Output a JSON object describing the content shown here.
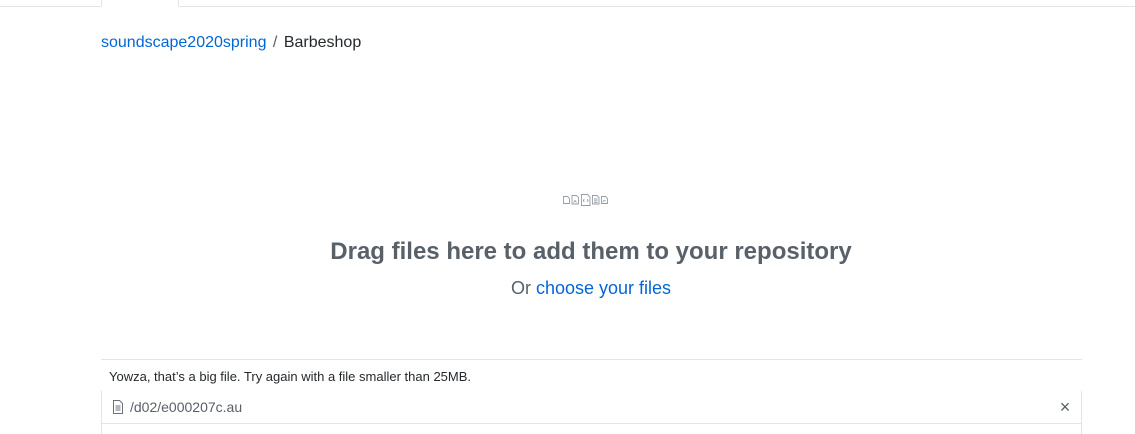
{
  "breadcrumb": {
    "owner": "soundscape2020spring",
    "separator": "/",
    "repo": "Barbeshop"
  },
  "dropzone": {
    "icons": [
      "file-icon",
      "file-media-icon",
      "file-code-icon",
      "file-text-icon",
      "file-pdf-icon"
    ],
    "title": "Drag files here to add them to your repository",
    "or_text": "Or",
    "choose_link": "choose your files"
  },
  "upload_error": {
    "message": "Yowza, that’s a big file. Try again with a file smaller than 25MB."
  },
  "files": [
    {
      "name": "/d02/e000207c.au",
      "remove_label": "×"
    }
  ],
  "colors": {
    "link": "#0366d6",
    "muted": "#586069",
    "border": "#e1e4e8"
  }
}
